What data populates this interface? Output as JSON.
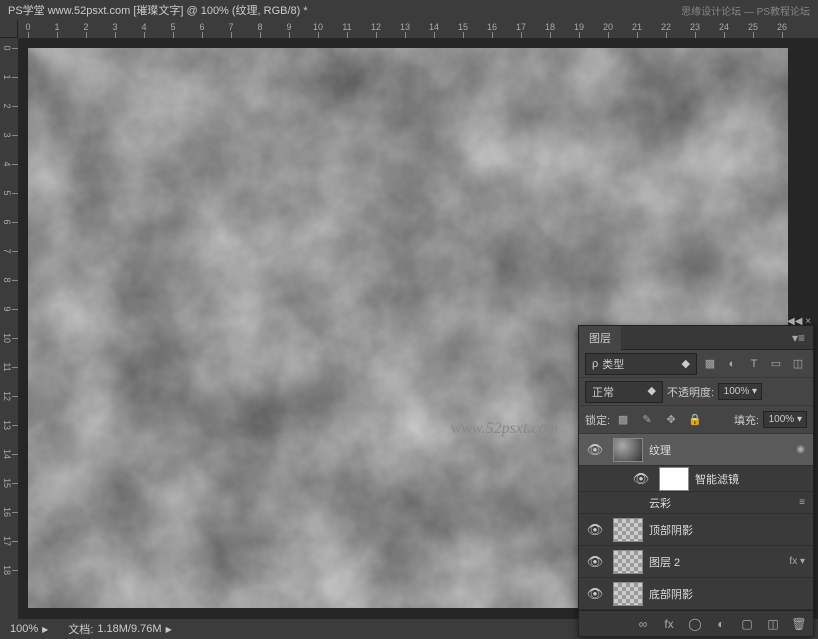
{
  "titlebar": {
    "title": "PS学堂  www.52psxt.com [璀璨文字] @ 100% (纹理, RGB/8) *",
    "right1": "思缘设计论坛",
    "right2": "PS教程论坛"
  },
  "ruler": {
    "top": [
      "0",
      "1",
      "2",
      "3",
      "4",
      "5",
      "6",
      "7",
      "8",
      "9",
      "10",
      "11",
      "12",
      "13",
      "14",
      "15",
      "16",
      "17",
      "18",
      "19",
      "20",
      "21",
      "22",
      "23",
      "24",
      "25",
      "26"
    ],
    "left": [
      "0",
      "1",
      "2",
      "3",
      "4",
      "5",
      "6",
      "7",
      "8",
      "9",
      "10",
      "11",
      "12",
      "13",
      "14",
      "15",
      "16",
      "17",
      "18"
    ]
  },
  "watermark": "www.52psxt.com",
  "statusbar": {
    "zoom": "100%",
    "doc_label": "文档:",
    "doc_value": "1.18M/9.76M"
  },
  "layers": {
    "panel_title": "图层",
    "filter_type_icon": "ρ",
    "filter_type": "类型",
    "blend_mode": "正常",
    "opacity_label": "不透明度:",
    "opacity_value": "100%",
    "lock_label": "锁定:",
    "fill_label": "填充:",
    "fill_value": "100%",
    "items": [
      {
        "name": "纹理",
        "thumb": "clouds-thumb",
        "selected": true,
        "eye": true,
        "smart": true
      },
      {
        "name": "智能滤镜",
        "thumb": "white",
        "filter": true,
        "eye": true
      },
      {
        "name": "云彩",
        "filter_sub": true,
        "toggle": "≡"
      },
      {
        "name": "顶部阴影",
        "thumb": "checker",
        "eye": true
      },
      {
        "name": "图层 2",
        "thumb": "checker",
        "eye": true,
        "fx": "fx"
      },
      {
        "name": "底部阴影",
        "thumb": "checker",
        "eye": true
      }
    ]
  }
}
